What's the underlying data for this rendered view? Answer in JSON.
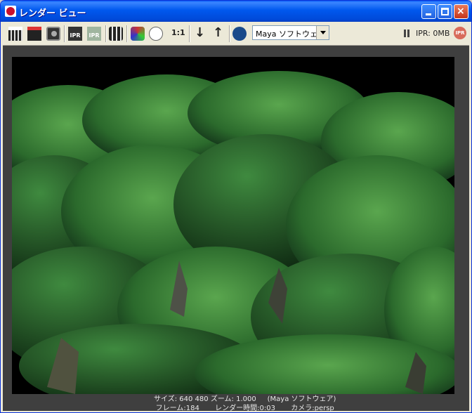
{
  "window": {
    "title": "レンダー ビュー"
  },
  "toolbar": {
    "ratio_label": "1:1",
    "renderer_value": "Maya ソフトウェア",
    "ipr_memory": "IPR: 0MB",
    "ipr_badge": "IPR",
    "ipr_icon_label": "IPR"
  },
  "status": {
    "size_label": "サイズ:",
    "width": "640",
    "height": "480",
    "zoom_label": "ズーム:",
    "zoom": "1.000",
    "renderer": "(Maya ソフトウェア)",
    "frame_label": "フレーム:",
    "frame": "184",
    "render_time_label": "レンダー時間:",
    "render_time": "0:03",
    "camera_label": "カメラ:",
    "camera": "persp"
  },
  "colors": {
    "foliage_dark": "#1c4a1f",
    "foliage_light": "#4d9a45",
    "background": "#000000"
  }
}
